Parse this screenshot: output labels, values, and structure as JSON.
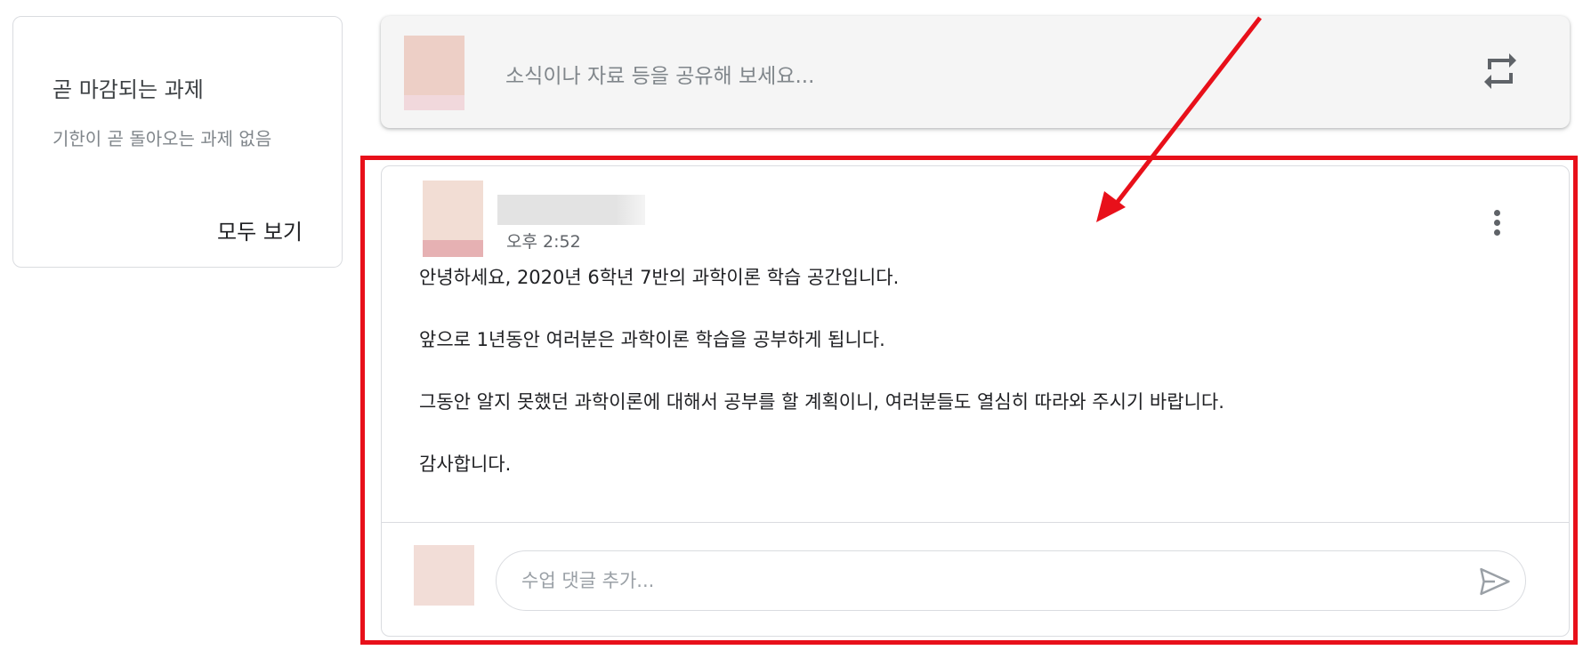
{
  "upcoming": {
    "title": "곧 마감되는 과제",
    "empty_text": "기한이 곧 돌아오는 과제 없음",
    "view_all": "모두 보기"
  },
  "share": {
    "placeholder": "소식이나 자료 등을 공유해 보세요...",
    "repost_icon": "repost-icon"
  },
  "post": {
    "time": "오후 2:52",
    "paragraphs": [
      "안녕하세요, 2020년 6학년 7반의 과학이론 학습 공간입니다.",
      "앞으로 1년동안 여러분은 과학이론 학습을 공부하게 됩니다.",
      "그동안 알지 못했던 과학이론에 대해서 공부를 할 계획이니, 여러분들도 열심히 따라와 주시기 바랍니다.",
      "감사합니다."
    ],
    "menu_icon": "more-vert-icon",
    "comment_placeholder": "수업 댓글 추가...",
    "send_icon": "send-icon"
  },
  "annotation": {
    "color": "#e8101a"
  }
}
